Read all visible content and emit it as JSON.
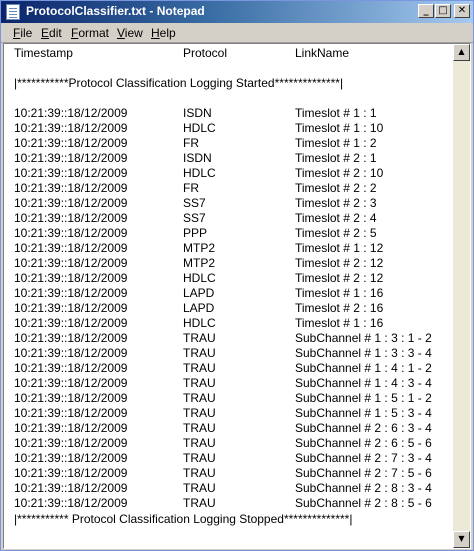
{
  "window": {
    "title": "ProtocolClassifier.txt - Notepad",
    "buttons": {
      "minimize": "_",
      "maximize": "□",
      "close": "✕"
    }
  },
  "menu": {
    "items": [
      {
        "accel": "F",
        "rest": "ile"
      },
      {
        "accel": "E",
        "rest": "dit"
      },
      {
        "accel": "F",
        "rest": "ormat"
      },
      {
        "accel": "V",
        "rest": "iew"
      },
      {
        "accel": "H",
        "rest": "elp"
      }
    ]
  },
  "document": {
    "header": {
      "timestamp": "Timestamp",
      "protocol": "Protocol",
      "linkname": "LinkName"
    },
    "banner_start": "|***********Protocol Classification Logging Started**************|",
    "rows": [
      {
        "ts": "10:21:39::18/12/2009",
        "protocol": "ISDN",
        "link": "Timeslot # 1 : 1"
      },
      {
        "ts": "10:21:39::18/12/2009",
        "protocol": "HDLC",
        "link": "Timeslot # 1 : 10"
      },
      {
        "ts": "10:21:39::18/12/2009",
        "protocol": "FR",
        "link": "Timeslot # 1 : 2"
      },
      {
        "ts": "10:21:39::18/12/2009",
        "protocol": "ISDN",
        "link": "Timeslot # 2 : 1"
      },
      {
        "ts": "10:21:39::18/12/2009",
        "protocol": "HDLC",
        "link": "Timeslot # 2 : 10"
      },
      {
        "ts": "10:21:39::18/12/2009",
        "protocol": "FR",
        "link": "Timeslot # 2 : 2"
      },
      {
        "ts": "10:21:39::18/12/2009",
        "protocol": "SS7",
        "link": "Timeslot # 2 : 3"
      },
      {
        "ts": "10:21:39::18/12/2009",
        "protocol": "SS7",
        "link": "Timeslot # 2 : 4"
      },
      {
        "ts": "10:21:39::18/12/2009",
        "protocol": "PPP",
        "link": "Timeslot # 2 : 5"
      },
      {
        "ts": "10:21:39::18/12/2009",
        "protocol": "MTP2",
        "link": "Timeslot # 1 : 12"
      },
      {
        "ts": "10:21:39::18/12/2009",
        "protocol": "MTP2",
        "link": "Timeslot # 2 : 12"
      },
      {
        "ts": "10:21:39::18/12/2009",
        "protocol": "HDLC",
        "link": "Timeslot # 2 : 12"
      },
      {
        "ts": "10:21:39::18/12/2009",
        "protocol": "LAPD",
        "link": "Timeslot # 1 : 16"
      },
      {
        "ts": "10:21:39::18/12/2009",
        "protocol": "LAPD",
        "link": "Timeslot # 2 : 16"
      },
      {
        "ts": "10:21:39::18/12/2009",
        "protocol": "HDLC",
        "link": "Timeslot # 1 : 16"
      },
      {
        "ts": "10:21:39::18/12/2009",
        "protocol": "TRAU",
        "link": "SubChannel # 1 : 3 : 1 - 2"
      },
      {
        "ts": "10:21:39::18/12/2009",
        "protocol": "TRAU",
        "link": "SubChannel # 1 : 3 : 3 - 4"
      },
      {
        "ts": "10:21:39::18/12/2009",
        "protocol": "TRAU",
        "link": "SubChannel # 1 : 4 : 1 - 2"
      },
      {
        "ts": "10:21:39::18/12/2009",
        "protocol": "TRAU",
        "link": "SubChannel # 1 : 4 : 3 - 4"
      },
      {
        "ts": "10:21:39::18/12/2009",
        "protocol": "TRAU",
        "link": "SubChannel # 1 : 5 : 1 - 2"
      },
      {
        "ts": "10:21:39::18/12/2009",
        "protocol": "TRAU",
        "link": "SubChannel # 1 : 5 : 3 - 4"
      },
      {
        "ts": "10:21:39::18/12/2009",
        "protocol": "TRAU",
        "link": "SubChannel # 2 : 6 : 3 - 4"
      },
      {
        "ts": "10:21:39::18/12/2009",
        "protocol": "TRAU",
        "link": "SubChannel # 2 : 6 : 5 - 6"
      },
      {
        "ts": "10:21:39::18/12/2009",
        "protocol": "TRAU",
        "link": "SubChannel # 2 : 7 : 3 - 4"
      },
      {
        "ts": "10:21:39::18/12/2009",
        "protocol": "TRAU",
        "link": "SubChannel # 2 : 7 : 5 - 6"
      },
      {
        "ts": "10:21:39::18/12/2009",
        "protocol": "TRAU",
        "link": "SubChannel # 2 : 8 : 3 - 4"
      },
      {
        "ts": "10:21:39::18/12/2009",
        "protocol": "TRAU",
        "link": "SubChannel # 2 : 8 : 5 - 6"
      }
    ],
    "banner_end": "|*********** Protocol Classification Logging Stopped**************|"
  },
  "scrollbar": {
    "up_arrow": "▲",
    "down_arrow": "▼"
  }
}
